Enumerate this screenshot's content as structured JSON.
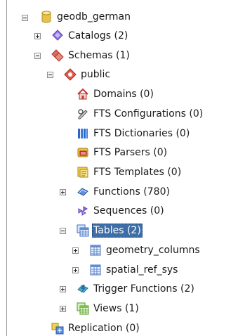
{
  "tree": {
    "database": {
      "label": "geodb_german",
      "icon": "database-icon"
    },
    "catalogs": {
      "label": "Catalogs (2)",
      "icon": "catalog-icon"
    },
    "schemas": {
      "label": "Schemas (1)",
      "icon": "schemas-icon"
    },
    "public": {
      "label": "public",
      "icon": "schema-icon"
    },
    "domains": {
      "label": "Domains (0)",
      "icon": "domain-icon"
    },
    "fts_configurations": {
      "label": "FTS Configurations (0)",
      "icon": "fts-configuration-icon"
    },
    "fts_dictionaries": {
      "label": "FTS Dictionaries (0)",
      "icon": "fts-dictionary-icon"
    },
    "fts_parsers": {
      "label": "FTS Parsers (0)",
      "icon": "fts-parser-icon"
    },
    "fts_templates": {
      "label": "FTS Templates (0)",
      "icon": "fts-template-icon"
    },
    "functions": {
      "label": "Functions (780)",
      "icon": "function-icon"
    },
    "sequences": {
      "label": "Sequences (0)",
      "icon": "sequence-icon"
    },
    "tables": {
      "label": "Tables (2)",
      "icon": "tables-icon",
      "selected": true
    },
    "table_items": [
      {
        "label": "geometry_columns",
        "icon": "table-icon"
      },
      {
        "label": "spatial_ref_sys",
        "icon": "table-icon"
      }
    ],
    "trigger_functions": {
      "label": "Trigger Functions (2)",
      "icon": "trigger-function-icon"
    },
    "views": {
      "label": "Views (1)",
      "icon": "view-icon"
    },
    "replication": {
      "label": "Replication (0)",
      "icon": "replication-icon"
    }
  },
  "colors": {
    "selection": "#3d6ea8",
    "database": "#e8c14a",
    "catalog": "#7b5bd1",
    "schema": "#d9534f",
    "function": "#4f7fd1",
    "table": "#5b8fd8",
    "view": "#7cc24a"
  }
}
